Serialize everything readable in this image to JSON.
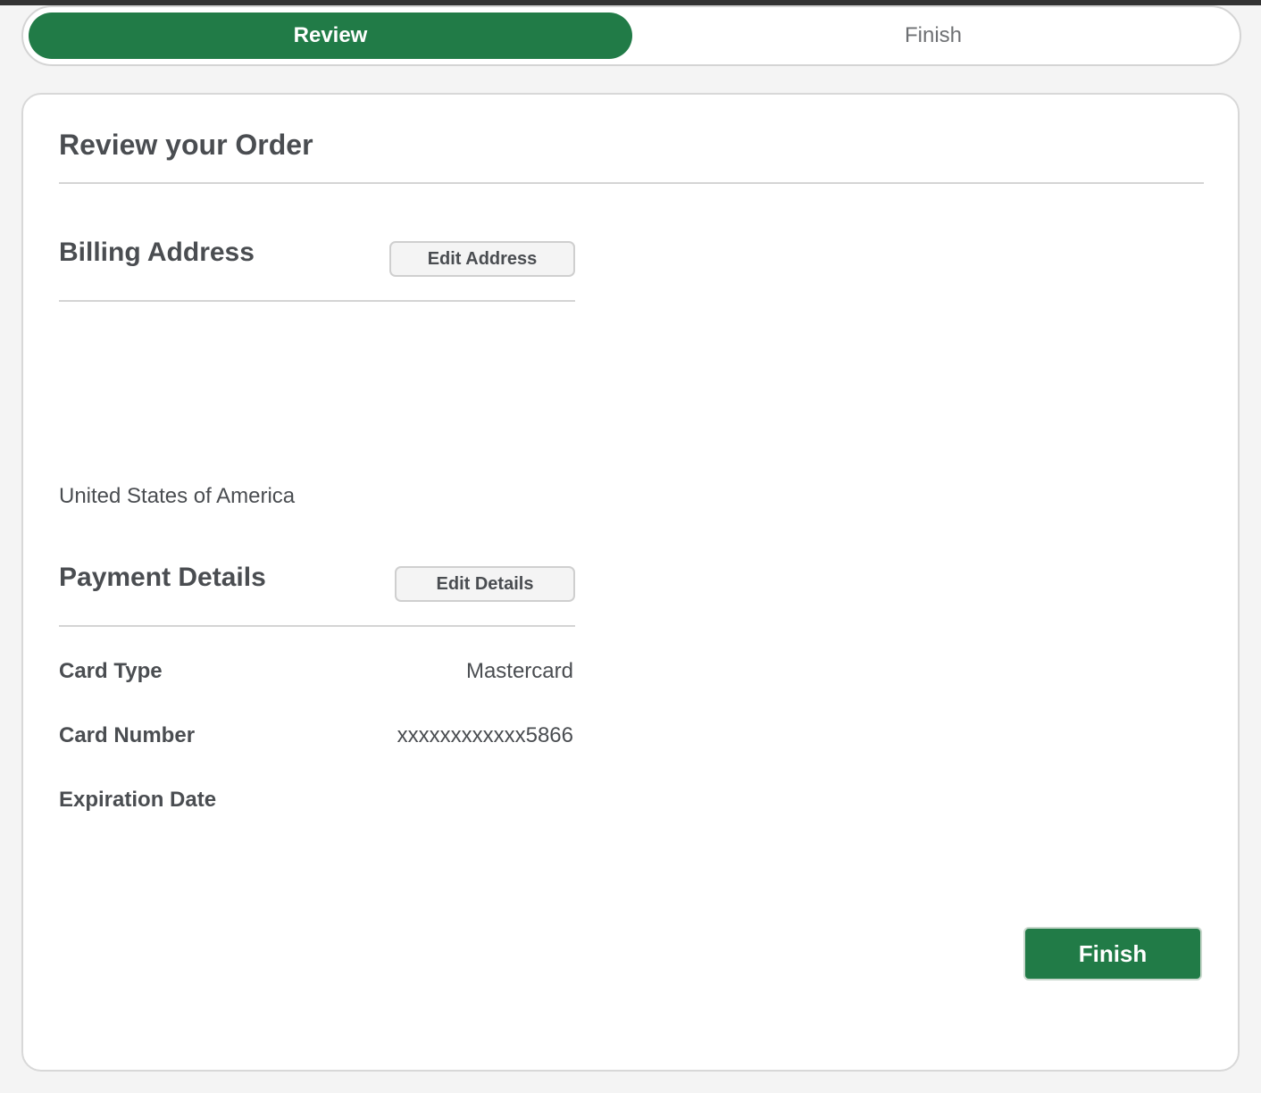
{
  "stepper": {
    "steps": [
      {
        "label": "Review",
        "active": true
      },
      {
        "label": "Finish",
        "active": false
      }
    ]
  },
  "order": {
    "title": "Review your Order"
  },
  "billing": {
    "title": "Billing Address",
    "edit_label": "Edit Address",
    "country": "United States of America"
  },
  "payment": {
    "title": "Payment Details",
    "edit_label": "Edit Details",
    "rows": [
      {
        "label": "Card Type",
        "value": "Mastercard"
      },
      {
        "label": "Card Number",
        "value": "xxxxxxxxxxxx5866"
      },
      {
        "label": "Expiration Date",
        "value": ""
      }
    ]
  },
  "actions": {
    "finish_label": "Finish"
  },
  "colors": {
    "accent": "#217b47",
    "text": "#4a4d51",
    "muted": "#6e7073",
    "border": "#d4d4d4",
    "page_bg": "#f4f4f4"
  }
}
